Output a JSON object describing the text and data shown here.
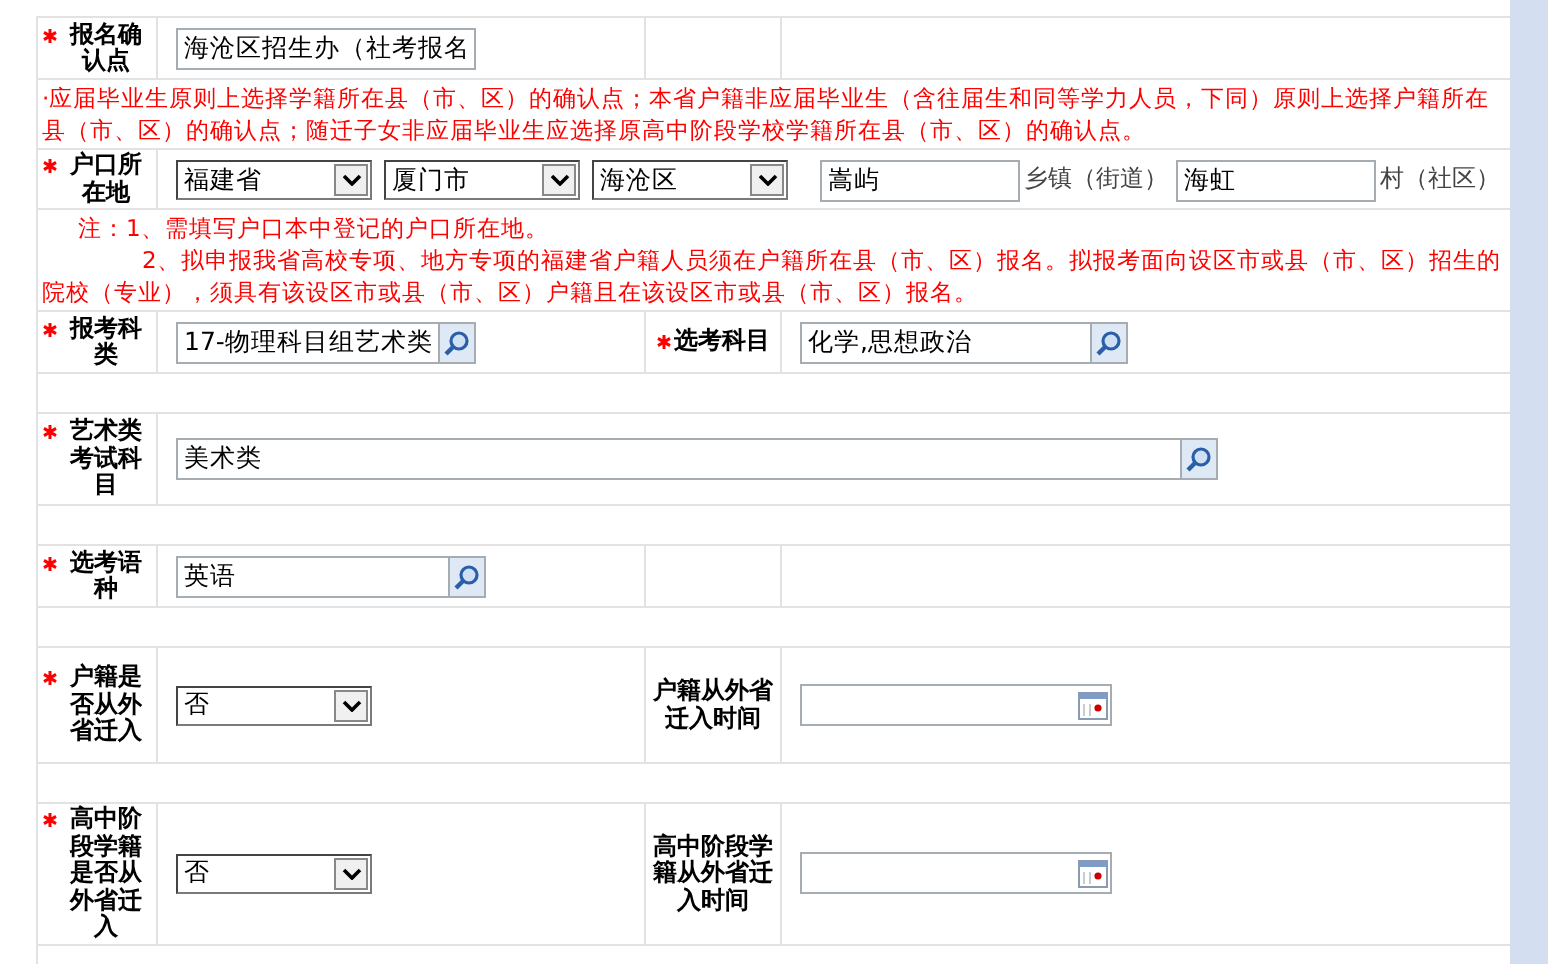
{
  "rows": [
    {
      "kind": "fields",
      "cells": [
        {
          "label": "报名确认点",
          "required": true,
          "control": {
            "kind": "text",
            "value": "海沧区招生办（社考报名"
          }
        }
      ]
    },
    {
      "kind": "note",
      "lines": [
        "·应届毕业生原则上选择学籍所在县（市、区）的确认点；本省户籍非应届毕业生（含往届生和同等学力人员，下同）原则上选择户籍所在县（市、区）的确认点；随迁子女非应届毕业生应选择原高中阶段学校学籍所在县（市、区）的确认点。"
      ]
    },
    {
      "kind": "address",
      "label": "户口所在地",
      "required": true,
      "selects": [
        "福建省",
        "厦门市",
        "海沧区"
      ],
      "town": "嵩屿",
      "town_suffix": "乡镇（街道）",
      "village": "海虹",
      "village_suffix": "村（社区）"
    },
    {
      "kind": "note",
      "lines": [
        "注：1、需填写户口本中登记的户口所在地。",
        "2、拟申报我省高校专项、地方专项的福建省户籍人员须在户籍所在县（市、区）报名。拟报考面向设区市或县（市、区）招生的院校（专业），须具有该设区市或县（市、区）户籍且在该设区市或县（市、区）报名。"
      ]
    },
    {
      "kind": "fields",
      "cells": [
        {
          "label": "报考科类",
          "required": true,
          "control": {
            "kind": "lookup",
            "value": "17-物理科目组艺术类"
          }
        },
        {
          "label": "选考科目",
          "required": true,
          "control": {
            "kind": "lookup",
            "value": "化学,思想政治"
          }
        }
      ]
    },
    {
      "kind": "spacer"
    },
    {
      "kind": "fields",
      "cells": [
        {
          "label": "艺术类考试科目",
          "required": true,
          "control": {
            "kind": "lookup",
            "value": "美术类",
            "wide": true
          }
        }
      ]
    },
    {
      "kind": "spacer"
    },
    {
      "kind": "fields",
      "cells": [
        {
          "label": "选考语种",
          "required": true,
          "control": {
            "kind": "lookup",
            "value": "英语"
          }
        }
      ]
    },
    {
      "kind": "spacer"
    },
    {
      "kind": "fields",
      "cells": [
        {
          "label": "户籍是否从外省迁入",
          "required": true,
          "control": {
            "kind": "select",
            "value": "否"
          }
        },
        {
          "label": "户籍从外省迁入时间",
          "required": false,
          "control": {
            "kind": "date"
          }
        }
      ]
    },
    {
      "kind": "spacer"
    },
    {
      "kind": "fields",
      "cells": [
        {
          "label": "高中阶段学籍是否从外省迁入",
          "required": true,
          "control": {
            "kind": "select",
            "value": "否"
          }
        },
        {
          "label": "高中阶段学籍从外省迁入时间",
          "required": false,
          "control": {
            "kind": "date"
          }
        }
      ]
    },
    {
      "kind": "spacer"
    }
  ]
}
